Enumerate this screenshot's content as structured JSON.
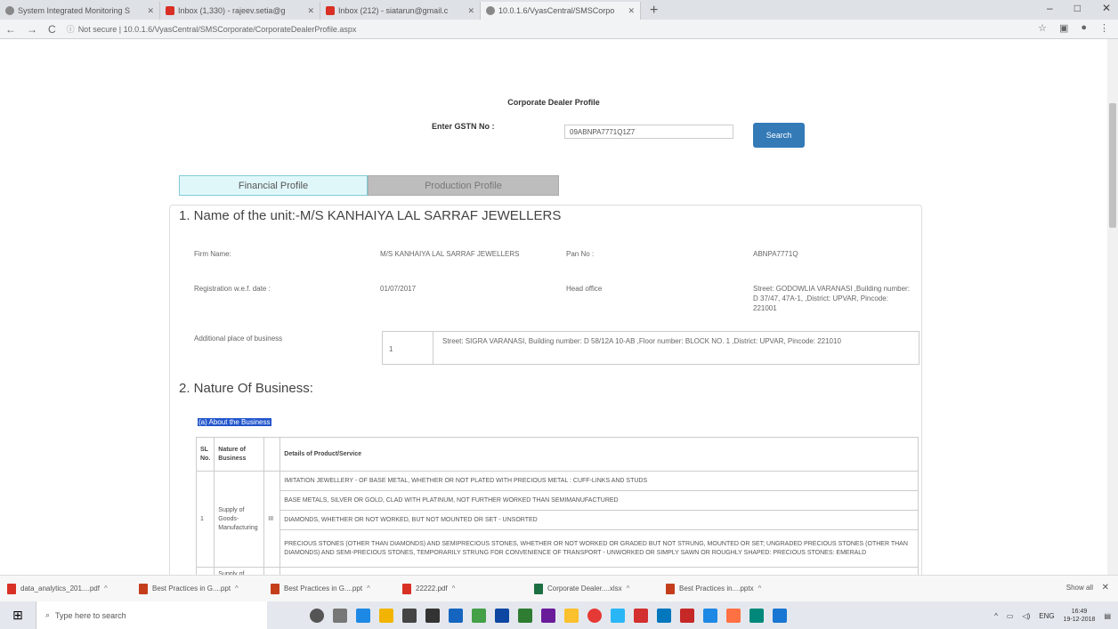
{
  "browser": {
    "tabs": [
      {
        "title": "System Integrated Monitoring S",
        "icon": "globe-icon"
      },
      {
        "title": "Inbox (1,330) - rajeev.setia@g",
        "icon": "gmail-icon"
      },
      {
        "title": "Inbox (212) - siatarun@gmail.c",
        "icon": "gmail-icon"
      },
      {
        "title": "10.0.1.6/VyasCentral/SMSCorpo",
        "icon": "globe-icon"
      }
    ],
    "url_security": "Not secure",
    "url": "10.0.1.6/VyasCentral/SMSCorporate/CorporateDealerProfile.aspx"
  },
  "page": {
    "title": "Corporate Dealer Profile",
    "gstin_label": "Enter GSTN No :",
    "gstin_value": "09ABNPA7771Q1Z7",
    "search_label": "Search",
    "tabs": [
      "Financial Profile",
      "Production Profile"
    ],
    "section1_title": "1. Name of the unit:-M/S KANHAIYA LAL SARRAF JEWELLERS",
    "firm_name_label": "Firm Name:",
    "firm_name": "M/S KANHAIYA LAL SARRAF JEWELLERS",
    "pan_label": "Pan No :",
    "pan": "ABNPA7771Q",
    "reg_label": "Registration w.e.f. date :",
    "reg_date": "01/07/2017",
    "head_office_label": "Head office",
    "head_office": "Street: GODOWLIA VARANASI ,Building number: D 37/47, 47A-1, ,District: UPVAR, Pincode: 221001",
    "additional_label": "Additional place of business",
    "additional_no": "1",
    "additional_addr": "Street: SIGRA VARANASI, Building number: D 58/12A 10-AB ,Floor number: BLOCK NO. 1 ,District: UPVAR, Pincode: 221010",
    "section2_title": "2. Nature Of Business:",
    "about_link": "(a) About the Business",
    "table": {
      "headers": [
        "SL No.",
        "Nature of Business",
        "",
        "Details of Product/Service"
      ],
      "row1": {
        "sl": "1",
        "nature": "Supply of Goods-Manufacturing",
        "mark": "III"
      },
      "details": [
        "IMITATION JEWELLERY - OF BASE METAL, WHETHER OR NOT PLATED WITH PRECIOUS METAL : CUFF-LINKS AND STUDS",
        "BASE METALS, SILVER OR GOLD, CLAD WITH PLATINUM, NOT FURTHER WORKED THAN SEMIMANUFACTURED",
        "DIAMONDS, WHETHER OR NOT WORKED, BUT NOT MOUNTED OR SET - UNSORTED",
        "PRECIOUS STONES (OTHER THAN DIAMONDS) AND SEMIPRECIOUS STONES, WHETHER OR NOT WORKED OR GRADED BUT NOT STRUNG, MOUNTED OR SET; UNGRADED PRECIOUS STONES (OTHER THAN DIAMONDS) AND SEMI-PRECIOUS STONES, TEMPORARILY STRUNG FOR CONVENIENCE OF TRANSPORT - UNWORKED OR SIMPLY SAWN OR ROUGHLY SHAPED: PRECIOUS STONES: EMERALD"
      ],
      "row2": {
        "nature": "Supply of"
      }
    }
  },
  "downloads": {
    "items": [
      "data_analytics_201....pdf",
      "Best Practices in G....ppt",
      "Best Practices in G....ppt",
      "22222.pdf",
      "Corporate Dealer....xlsx",
      "Best Practices in....pptx"
    ],
    "show_all": "Show all"
  },
  "taskbar": {
    "search_placeholder": "Type here to search",
    "lang": "ENG",
    "time": "16:49",
    "date": "19-12-2018"
  }
}
